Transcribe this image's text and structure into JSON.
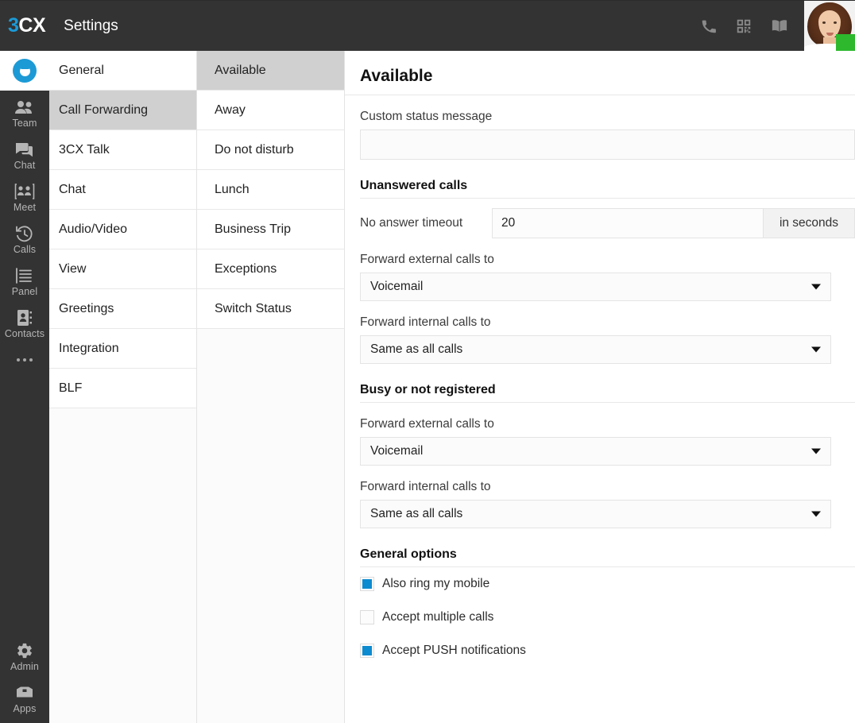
{
  "topbar": {
    "logo_3": "3",
    "logo_cx": "CX",
    "title": "Settings",
    "icons": [
      {
        "name": "phone-icon",
        "label": "Phone"
      },
      {
        "name": "qr-code-icon",
        "label": "QR code"
      },
      {
        "name": "phonebook-icon",
        "label": "Phonebook"
      }
    ],
    "avatar_status_color": "#2eb82e"
  },
  "rail": {
    "logo_name": "3cx-app-logo",
    "items": [
      {
        "label": "Team",
        "icon": "team-icon"
      },
      {
        "label": "Chat",
        "icon": "chat-icon"
      },
      {
        "label": "Meet",
        "icon": "meet-icon"
      },
      {
        "label": "Calls",
        "icon": "calls-history-icon"
      },
      {
        "label": "Panel",
        "icon": "panel-icon"
      },
      {
        "label": "Contacts",
        "icon": "contacts-icon"
      }
    ],
    "more_label": "...",
    "bottom_items": [
      {
        "label": "Admin",
        "icon": "gear-icon"
      },
      {
        "label": "Apps",
        "icon": "apps-icon"
      }
    ]
  },
  "settings_sections": {
    "items": [
      {
        "label": "General",
        "active": false
      },
      {
        "label": "Call Forwarding",
        "active": true
      },
      {
        "label": "3CX Talk",
        "active": false
      },
      {
        "label": "Chat",
        "active": false
      },
      {
        "label": "Audio/Video",
        "active": false
      },
      {
        "label": "View",
        "active": false
      },
      {
        "label": "Greetings",
        "active": false
      },
      {
        "label": "Integration",
        "active": false
      },
      {
        "label": "BLF",
        "active": false
      }
    ]
  },
  "status_profiles": {
    "items": [
      {
        "label": "Available",
        "active": true
      },
      {
        "label": "Away",
        "active": false
      },
      {
        "label": "Do not disturb",
        "active": false
      },
      {
        "label": "Lunch",
        "active": false
      },
      {
        "label": "Business Trip",
        "active": false
      },
      {
        "label": "Exceptions",
        "active": false
      },
      {
        "label": "Switch Status",
        "active": false
      }
    ]
  },
  "main": {
    "title": "Available",
    "custom_status": {
      "label": "Custom status message",
      "value": "",
      "placeholder": ""
    },
    "unanswered": {
      "heading": "Unanswered calls",
      "timeout_label": "No answer timeout",
      "timeout_value": "20",
      "timeout_suffix": "in seconds",
      "external_label": "Forward external calls to",
      "external_value": "Voicemail",
      "internal_label": "Forward internal calls to",
      "internal_value": "Same as all calls"
    },
    "busy": {
      "heading": "Busy or not registered",
      "external_label": "Forward external calls to",
      "external_value": "Voicemail",
      "internal_label": "Forward internal calls to",
      "internal_value": "Same as all calls"
    },
    "general_options": {
      "heading": "General options",
      "options": [
        {
          "label": "Also ring my mobile",
          "checked": true
        },
        {
          "label": "Accept multiple calls",
          "checked": false
        },
        {
          "label": "Accept PUSH notifications",
          "checked": true
        }
      ]
    }
  },
  "colors": {
    "topbar": "#333333",
    "accent_blue": "#1c9ad6",
    "checkbox_blue": "#0d8bd0",
    "status_green": "#2eb82e",
    "active_row": "#d0d0d0"
  }
}
